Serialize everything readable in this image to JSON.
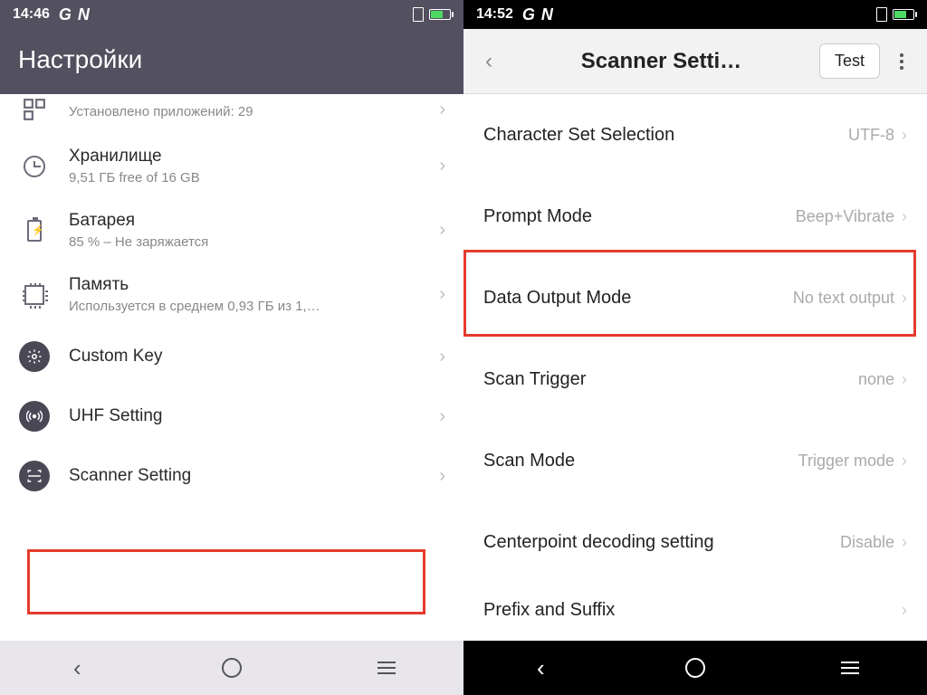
{
  "left": {
    "status": {
      "time": "14:46",
      "gn": "G N"
    },
    "header_title": "Настройки",
    "items": [
      {
        "title": "",
        "subtitle": "Установлено приложений: 29",
        "icon": "apps-icon"
      },
      {
        "title": "Хранилище",
        "subtitle": "9,51 ГБ free of 16 GB",
        "icon": "clock-icon"
      },
      {
        "title": "Батарея",
        "subtitle": "85 % – Не заряжается",
        "icon": "battery-icon"
      },
      {
        "title": "Память",
        "subtitle": "Используется в среднем 0,93 ГБ из 1,…",
        "icon": "chip-icon"
      },
      {
        "title": "Custom Key",
        "subtitle": "",
        "icon": "gear-icon"
      },
      {
        "title": "UHF Setting",
        "subtitle": "",
        "icon": "antenna-icon"
      },
      {
        "title": "Scanner Setting",
        "subtitle": "",
        "icon": "scanner-icon"
      }
    ]
  },
  "right": {
    "status": {
      "time": "14:52",
      "gn": "G N"
    },
    "header_title": "Scanner Setti…",
    "test_label": "Test",
    "items": [
      {
        "title": "Character Set Selection",
        "value": "UTF-8"
      },
      {
        "title": "Prompt Mode",
        "value": "Beep+Vibrate"
      },
      {
        "title": "Data Output Mode",
        "value": "No text output"
      },
      {
        "title": "Scan Trigger",
        "value": "none"
      },
      {
        "title": "Scan Mode",
        "value": "Trigger mode"
      },
      {
        "title": "Centerpoint decoding setting",
        "value": "Disable"
      },
      {
        "title": "Prefix and Suffix",
        "value": ""
      }
    ]
  }
}
